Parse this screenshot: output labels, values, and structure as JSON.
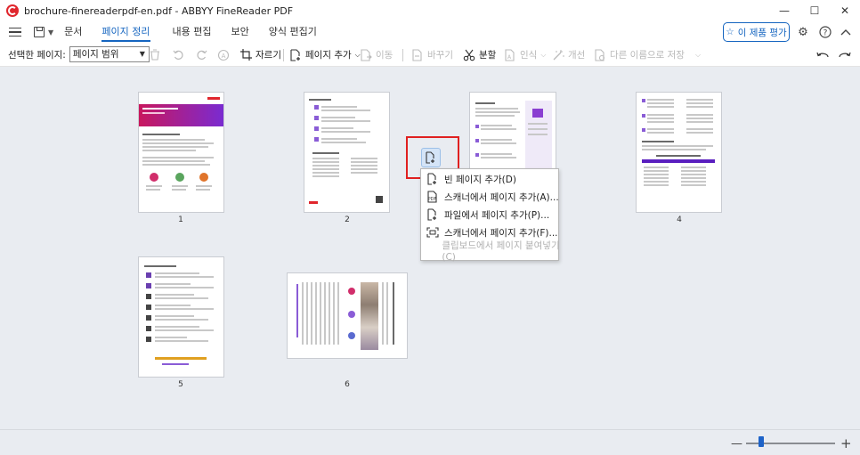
{
  "window": {
    "title": "brochure-finereaderpdf-en.pdf - ABBYY FineReader PDF",
    "controls": [
      "—",
      "☐",
      "✕"
    ]
  },
  "menubar": {
    "items": [
      {
        "label": "문서",
        "active": false
      },
      {
        "label": "페이지 정리",
        "active": true
      },
      {
        "label": "내용 편집",
        "active": false
      },
      {
        "label": "보안",
        "active": false
      },
      {
        "label": "양식 편집기",
        "active": false
      }
    ],
    "rate_label": "이 제품 평가"
  },
  "toolbar": {
    "selected_pages_label": "선택한 페이지:",
    "page_range_value": "페이지 범위",
    "crop_label": "자르기",
    "add_page_label": "페이지 추가",
    "move_label": "이동",
    "replace_label": "바꾸기",
    "split_label": "분할",
    "recognize_label": "인식",
    "improve_label": "개선",
    "save_as_label": "다른 이름으로 저장"
  },
  "pages": [
    {
      "number": "1"
    },
    {
      "number": "2"
    },
    {
      "number": "3"
    },
    {
      "number": "4"
    },
    {
      "number": "5"
    },
    {
      "number": "6"
    }
  ],
  "context_menu": {
    "items": [
      {
        "label": "빈 페이지 추가(D)",
        "enabled": true,
        "icon": "blank-page-icon"
      },
      {
        "label": "스캐너에서 페이지 추가(A)...",
        "enabled": true,
        "icon": "scanner-page-icon"
      },
      {
        "label": "파일에서 페이지 추가(P)...",
        "enabled": true,
        "icon": "file-page-icon"
      },
      {
        "label": "스캐너에서 페이지 추가(F)...",
        "enabled": true,
        "icon": "scanner-frame-icon"
      },
      {
        "label": "클립보드에서 페이지 붙여넣기(C)",
        "enabled": false,
        "icon": "none"
      }
    ]
  },
  "status": {
    "zoom_minus": "—",
    "zoom_plus": "+"
  },
  "colors": {
    "accent": "#1565c0",
    "brand_red": "#e0262d",
    "workspace_bg": "#e9ecf1",
    "highlight": "#e02020"
  }
}
